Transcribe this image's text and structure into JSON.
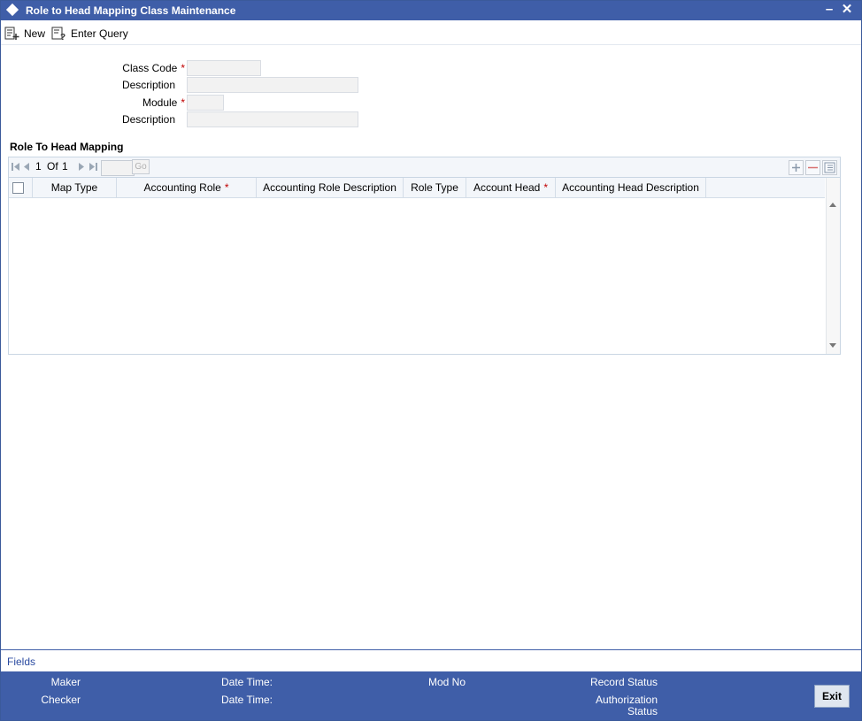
{
  "window": {
    "title": "Role to Head Mapping Class Maintenance"
  },
  "toolbar": {
    "new_label": "New",
    "enter_query_label": "Enter Query"
  },
  "form": {
    "class_code_label": "Class Code",
    "description_label": "Description",
    "module_label": "Module",
    "module_description_label": "Description",
    "required_marker": "*",
    "class_code_value": "",
    "description_value": "",
    "module_value": "",
    "module_description_value": ""
  },
  "section": {
    "title": "Role To Head Mapping"
  },
  "pager": {
    "current": "1",
    "of_label": "Of",
    "total": "1",
    "go_label": "Go",
    "page_input": ""
  },
  "grid": {
    "columns": [
      "Map Type",
      "Accounting Role",
      "Accounting Role Description",
      "Role Type",
      "Account Head",
      "Accounting Head Description"
    ],
    "required_marker": "*",
    "rows": []
  },
  "footer": {
    "fields_link": "Fields",
    "maker_label": "Maker",
    "checker_label": "Checker",
    "date_time_label_1": "Date Time:",
    "date_time_label_2": "Date Time:",
    "mod_no_label": "Mod No",
    "record_status_label": "Record Status",
    "authorization_label": "Authorization",
    "status_label": "Status",
    "exit_label": "Exit"
  },
  "colors": {
    "title_bar": "#3f5ea8",
    "required": "#c00000",
    "link": "#2a4aa0"
  },
  "icons": [
    "diamond-icon",
    "minimize-icon",
    "close-icon",
    "new-icon",
    "enter-query-icon",
    "first-page-icon",
    "prev-page-icon",
    "next-page-icon",
    "last-page-icon",
    "add-row-icon",
    "delete-row-icon",
    "single-view-icon"
  ]
}
